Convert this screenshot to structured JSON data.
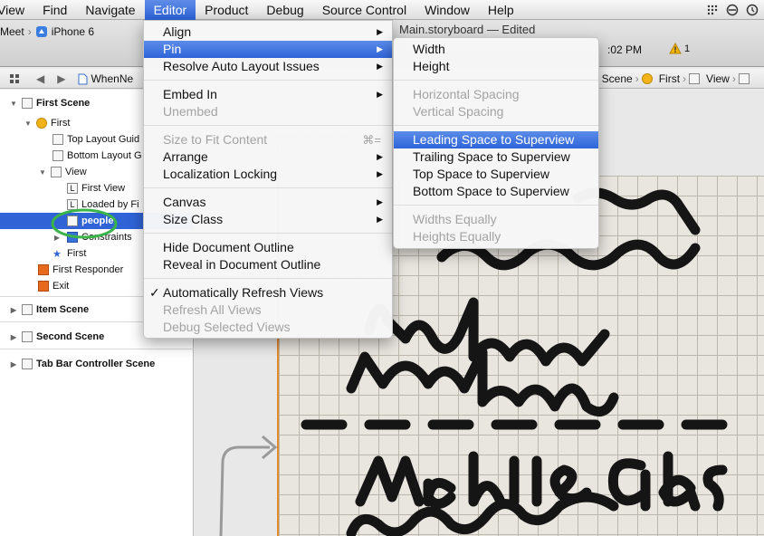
{
  "menubar": {
    "items": [
      "View",
      "Find",
      "Navigate",
      "Editor",
      "Product",
      "Debug",
      "Source Control",
      "Window",
      "Help"
    ],
    "active_index": 3
  },
  "toolbar": {
    "scheme": "Meet",
    "device": "iPhone 6",
    "window_title": "Main.storyboard — Edited",
    "time": ":02 PM",
    "warning_count": "1"
  },
  "jumpbar": {
    "file": "WhenNe",
    "crumbs": [
      "t Scene",
      "First",
      "View"
    ]
  },
  "outline": {
    "first_scene": "First Scene",
    "first": "First",
    "top_layout": "Top Layout Guid",
    "bottom_layout": "Bottom Layout G",
    "view": "View",
    "first_view": "First View",
    "loaded_by": "Loaded by Fi",
    "people": "people",
    "constraints": "Constraints",
    "first_tab": "First",
    "first_responder": "First Responder",
    "exit": "Exit",
    "item_scene": "Item Scene",
    "second_scene": "Second Scene",
    "tab_bar_scene": "Tab Bar Controller Scene"
  },
  "editor_menu": {
    "align": "Align",
    "pin": "Pin",
    "resolve": "Resolve Auto Layout Issues",
    "embed_in": "Embed In",
    "unembed": "Unembed",
    "size_to_fit": "Size to Fit Content",
    "size_to_fit_shortcut": "⌘=",
    "arrange": "Arrange",
    "localization_locking": "Localization Locking",
    "canvas": "Canvas",
    "size_class": "Size Class",
    "hide_outline": "Hide Document Outline",
    "reveal_outline": "Reveal in Document Outline",
    "auto_refresh": "Automatically Refresh Views",
    "refresh_all": "Refresh All Views",
    "debug_selected": "Debug Selected Views"
  },
  "pin_menu": {
    "width": "Width",
    "height": "Height",
    "horizontal_spacing": "Horizontal Spacing",
    "vertical_spacing": "Vertical Spacing",
    "leading": "Leading Space to Superview",
    "trailing": "Trailing Space to Superview",
    "top": "Top Space to Superview",
    "bottom": "Bottom Space to Superview",
    "widths_equally": "Widths Equally",
    "heights_equally": "Heights Equally"
  },
  "colors": {
    "highlight": "#2f64d9",
    "selection_ring": "#3bb44a"
  }
}
